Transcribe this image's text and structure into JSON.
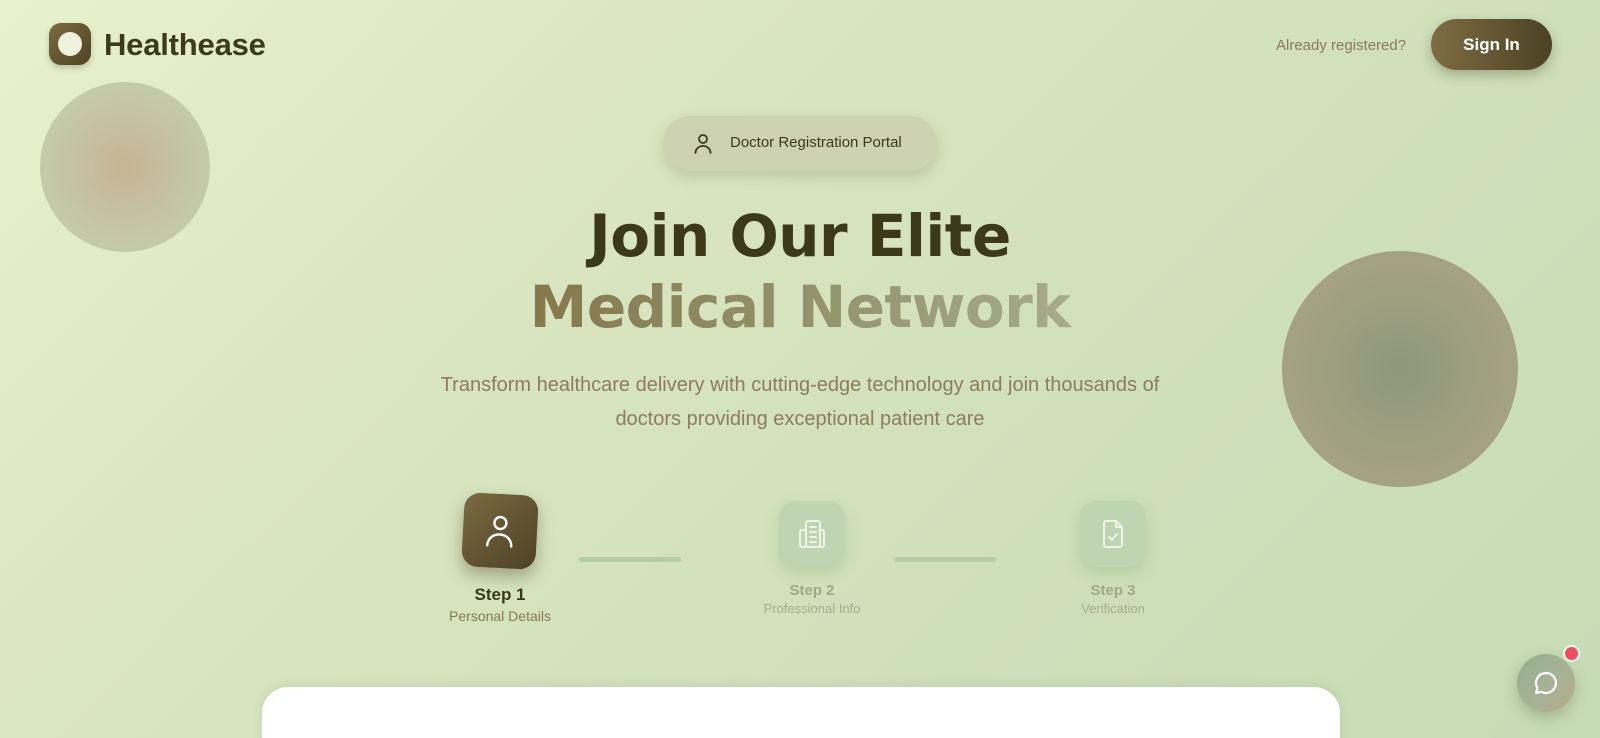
{
  "header": {
    "brand": "Healthease",
    "already_registered": "Already registered?",
    "signin_label": "Sign In"
  },
  "badge": {
    "label": "Doctor Registration Portal",
    "icon": "user-icon"
  },
  "hero": {
    "line1": "Join Our Elite",
    "line2": "Medical Network",
    "subtitle_line1": "Transform healthcare delivery with cutting-edge technology and join thousands of",
    "subtitle_line2": "doctors providing exceptional patient care"
  },
  "steps": [
    {
      "title": "Step 1",
      "subtitle": "Personal Details",
      "icon": "user-icon",
      "active": true
    },
    {
      "title": "Step 2",
      "subtitle": "Professional Info",
      "icon": "building-icon",
      "active": false
    },
    {
      "title": "Step 3",
      "subtitle": "Verification",
      "icon": "document-check-icon",
      "active": false
    }
  ],
  "chat": {
    "icon": "chat-bubble-icon",
    "has_notification": true
  },
  "colors": {
    "brand_dark": "#4a4223",
    "brand_light": "#7f6c44",
    "accent_muted": "#8b7a57",
    "inactive_step": "#bfd4b0",
    "notification": "#ef4f5c"
  }
}
